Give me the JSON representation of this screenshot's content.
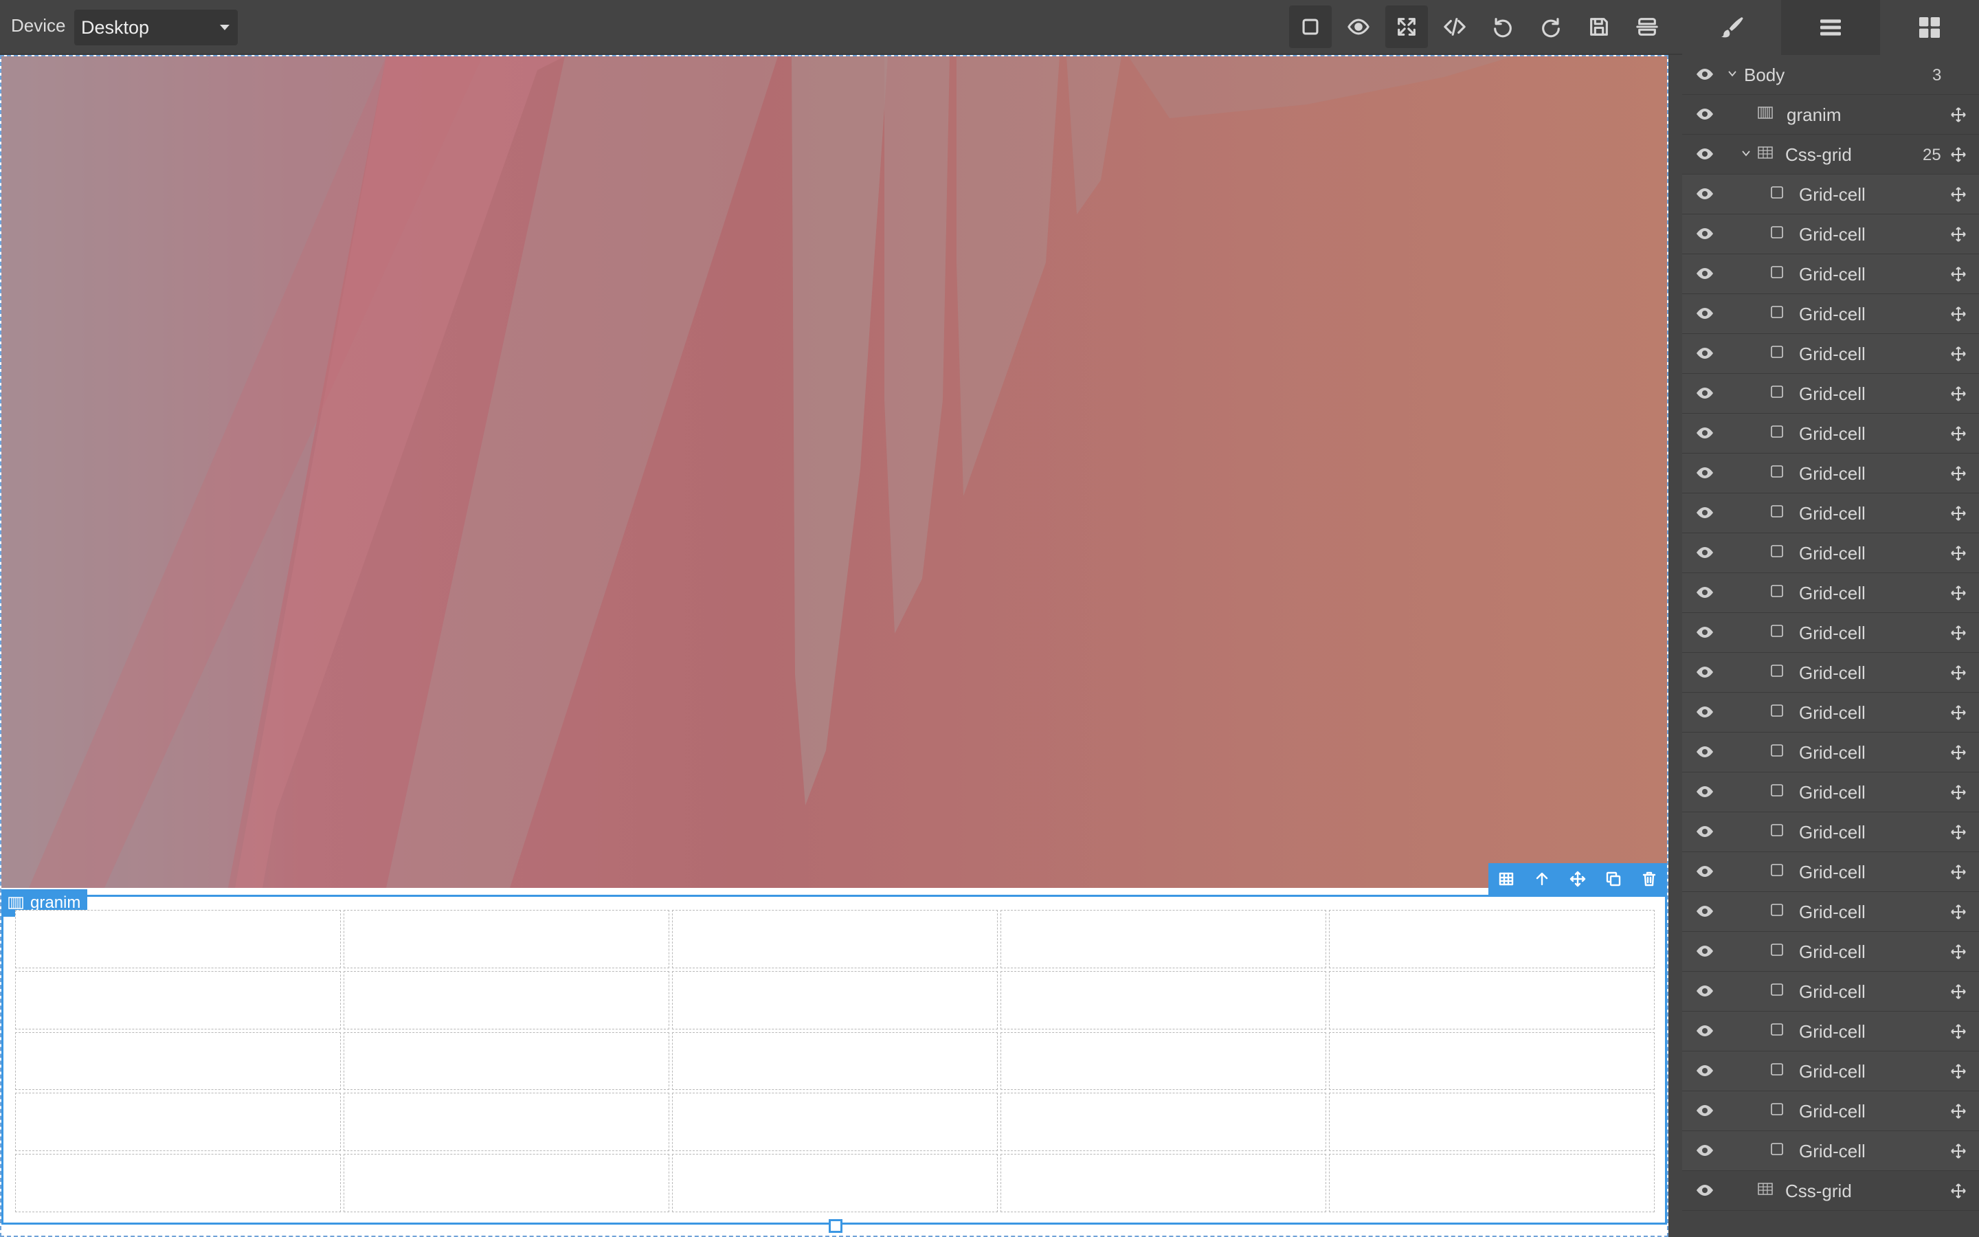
{
  "toolbar": {
    "device_label": "Device",
    "device_value": "Desktop",
    "buttons": [
      {
        "name": "sw-visibility",
        "icon": "square-icon",
        "active": true
      },
      {
        "name": "preview",
        "icon": "eye-icon",
        "active": false
      },
      {
        "name": "fullscreen",
        "icon": "fullscreen-icon",
        "active": true
      },
      {
        "name": "export-code",
        "icon": "code-icon",
        "active": false
      },
      {
        "name": "undo",
        "icon": "undo-icon",
        "active": false
      },
      {
        "name": "redo",
        "icon": "redo-icon",
        "active": false
      },
      {
        "name": "save",
        "icon": "save-icon",
        "active": false
      },
      {
        "name": "clear-canvas",
        "icon": "canvas-clear-icon",
        "active": false
      }
    ]
  },
  "panel_tabs": [
    {
      "name": "style-manager",
      "icon": "brush-icon",
      "active": false
    },
    {
      "name": "layer-manager",
      "icon": "bars-icon",
      "active": true
    },
    {
      "name": "blocks",
      "icon": "blocks-icon",
      "active": false
    }
  ],
  "layers": {
    "body": {
      "label": "Body",
      "count": "3"
    },
    "granim": {
      "label": "granim"
    },
    "css_grid": {
      "label": "Css-grid",
      "count": "25"
    },
    "cells": [
      "Grid-cell",
      "Grid-cell",
      "Grid-cell",
      "Grid-cell",
      "Grid-cell",
      "Grid-cell",
      "Grid-cell",
      "Grid-cell",
      "Grid-cell",
      "Grid-cell",
      "Grid-cell",
      "Grid-cell",
      "Grid-cell",
      "Grid-cell",
      "Grid-cell",
      "Grid-cell",
      "Grid-cell",
      "Grid-cell",
      "Grid-cell",
      "Grid-cell",
      "Grid-cell",
      "Grid-cell",
      "Grid-cell",
      "Grid-cell",
      "Grid-cell"
    ],
    "css_grid_2": {
      "label": "Css-grid"
    }
  },
  "selection": {
    "badge_label": "granim",
    "toolbar": [
      "grid-icon",
      "arrow-up-icon",
      "move-icon",
      "clone-icon",
      "trash-icon"
    ]
  },
  "colors": {
    "accent": "#3b97e3",
    "panel_bg": "#444444",
    "gradient_start": "#a88c92",
    "gradient_end": "#bb7d6d"
  }
}
